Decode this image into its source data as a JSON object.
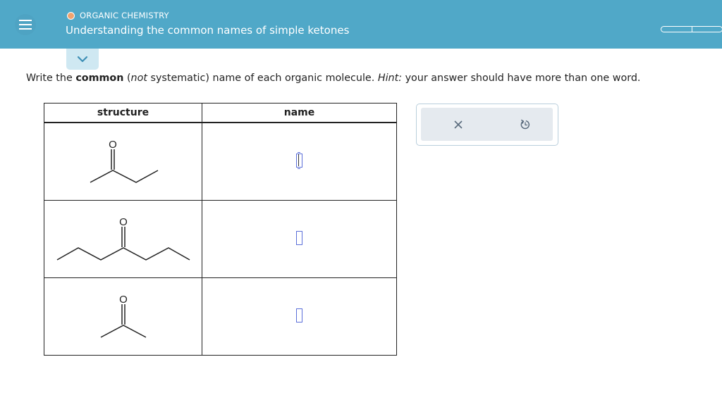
{
  "header": {
    "topic": "ORGANIC CHEMISTRY",
    "title": "Understanding the common names of simple ketones",
    "menu_icon": "menu-icon",
    "progress_segments": 2
  },
  "question": {
    "part1": "Write the ",
    "bold": "common",
    "part2": " (",
    "italic": "not",
    "part3": " systematic) name of each organic molecule. ",
    "hint_label": "Hint:",
    "hint_text": " your answer should have more than one word."
  },
  "table": {
    "headers": [
      "structure",
      "name"
    ],
    "rows": [
      {
        "atom_label": "O",
        "answer": ""
      },
      {
        "atom_label": "O",
        "answer": ""
      },
      {
        "atom_label": "O",
        "answer": ""
      }
    ]
  },
  "tools": {
    "clear_icon": "close-icon",
    "undo_icon": "undo-icon"
  },
  "colors": {
    "header_bg": "#50a8c8",
    "accent": "#5b6fd9",
    "topic_dot": "#f0a36f"
  }
}
